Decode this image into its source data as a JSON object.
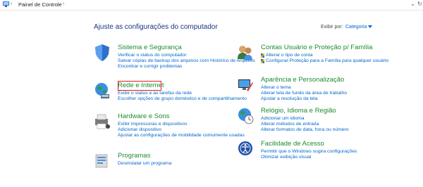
{
  "address_bar": {
    "segment": "Painel de Controle"
  },
  "page": {
    "title": "Ajuste as configurações do computador",
    "view_by_label": "Exibir por:",
    "view_by_value": "Categoria"
  },
  "left_categories": [
    {
      "title": "Sistema e Segurança",
      "links": [
        "Verificar o status do computador",
        "Salvar cópias de backup dos arquivos com Histórico de Arquivos",
        "Encontrar e corrigir problemas"
      ]
    },
    {
      "title": "Rede e Internet",
      "links": [
        "Exibir o status e as tarefas da rede",
        "Escolher opções de grupo doméstico e de compartilhamento"
      ]
    },
    {
      "title": "Hardware e Sons",
      "links": [
        "Exibir impressoras e dispositivos",
        "Adicionar dispositivo",
        "Ajustar as configurações de mobilidade comumente usadas"
      ]
    },
    {
      "title": "Programas",
      "links": [
        "Desinstalar um programa"
      ]
    }
  ],
  "right_categories": [
    {
      "title": "Contas Usuário e Proteção p/ Família",
      "links": [
        "Alterar o tipo de conta",
        "Configurar Proteção para a Família para qualquer usuário"
      ]
    },
    {
      "title": "Aparência e Personalização",
      "links": [
        "Alterar o tema",
        "Alterar tela de fundo da área de trabalho",
        "Ajustar a resolução da tela"
      ]
    },
    {
      "title": "Relógio, Idioma e Região",
      "links": [
        "Adicionar um idioma",
        "Alterar métodos de entrada",
        "Alterar formatos de data, hora ou número"
      ]
    },
    {
      "title": "Facilidade de Acesso",
      "links": [
        "Permitir que o Windows sugira configurações",
        "Otimizar exibição visual"
      ]
    }
  ],
  "colors": {
    "category_title": "#1d8c2d",
    "link": "#0066cc",
    "page_title": "#1e3287",
    "highlight": "#e01b1b"
  },
  "highlighted_item": "Rede e Internet"
}
